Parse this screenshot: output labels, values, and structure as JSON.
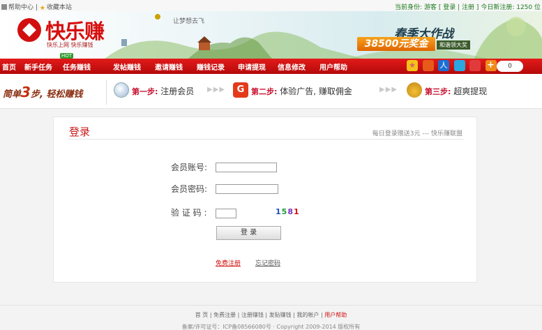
{
  "topbar": {
    "help_center": "帮助中心",
    "sep": "|",
    "bookmark": "收藏本站",
    "identity_label": "当前身份:",
    "identity_value": "游客",
    "bracket_open": "[",
    "login": "登录",
    "pipe": "|",
    "register": "注册",
    "bracket_close": "]",
    "today_label": "今日新注册:",
    "today_count": "1250 位"
  },
  "header": {
    "logo_title": "快乐赚",
    "logo_sub": "快乐上网 快乐赚钱",
    "tagline": "让梦想去飞",
    "promo_top": "春季大作战",
    "promo_amount": "38500元奖金",
    "promo_tag": "和谐领大奖",
    "hot_badge": "HOT"
  },
  "nav": {
    "items": [
      "首页",
      "新手任务",
      "任务赚钱",
      "发帖赚钱",
      "邀请赚钱",
      "赚钱记录",
      "申请提现",
      "信息修改",
      "用户帮助"
    ],
    "count": "0"
  },
  "steps": {
    "title_prefix": "简单",
    "title_num": "3",
    "title_suffix": "步, 轻松赚钱",
    "arrows": "▶▶▶",
    "step1_label": "第一步:",
    "step1_text": "注册会员",
    "step2_label": "第二步:",
    "step2_text": "体验广告, 赚取佣金",
    "step3_label": "第三步:",
    "step3_text": "超爽提现"
  },
  "login": {
    "title": "登录",
    "note": "每日登录赠送3元 --- 快乐赚联盟",
    "account_label": "会员账号:",
    "account_value": "",
    "password_label": "会员密码:",
    "password_value": "",
    "captcha_label": "验 证 码 :",
    "captcha_value": "",
    "captcha_digits": [
      "1",
      "5",
      "8",
      "1"
    ],
    "submit": "登 录",
    "register_link": "免费注册",
    "forgot_link": "忘记密码"
  },
  "footer": {
    "links": [
      "首 页",
      "免费注册",
      "注册赚钱",
      "发贴赚钱",
      "我的帐户"
    ],
    "highlight_link": "用户帮助",
    "copyright": "备案/许可证号：ICP备08566080号 · Copyright 2009-2014 版权所有"
  },
  "colors": {
    "brand_red": "#d70e0e",
    "nav_red": "#c81212",
    "captcha": [
      "#1f4fbf",
      "#1f9a3a",
      "#7b2fbf",
      "#d21010"
    ]
  },
  "icons": [
    "mouse-icon",
    "g-badge-icon",
    "money-bag-icon",
    "star-icon",
    "camera-icon",
    "person-icon",
    "chat-icon",
    "weibo-icon",
    "plus-icon"
  ]
}
